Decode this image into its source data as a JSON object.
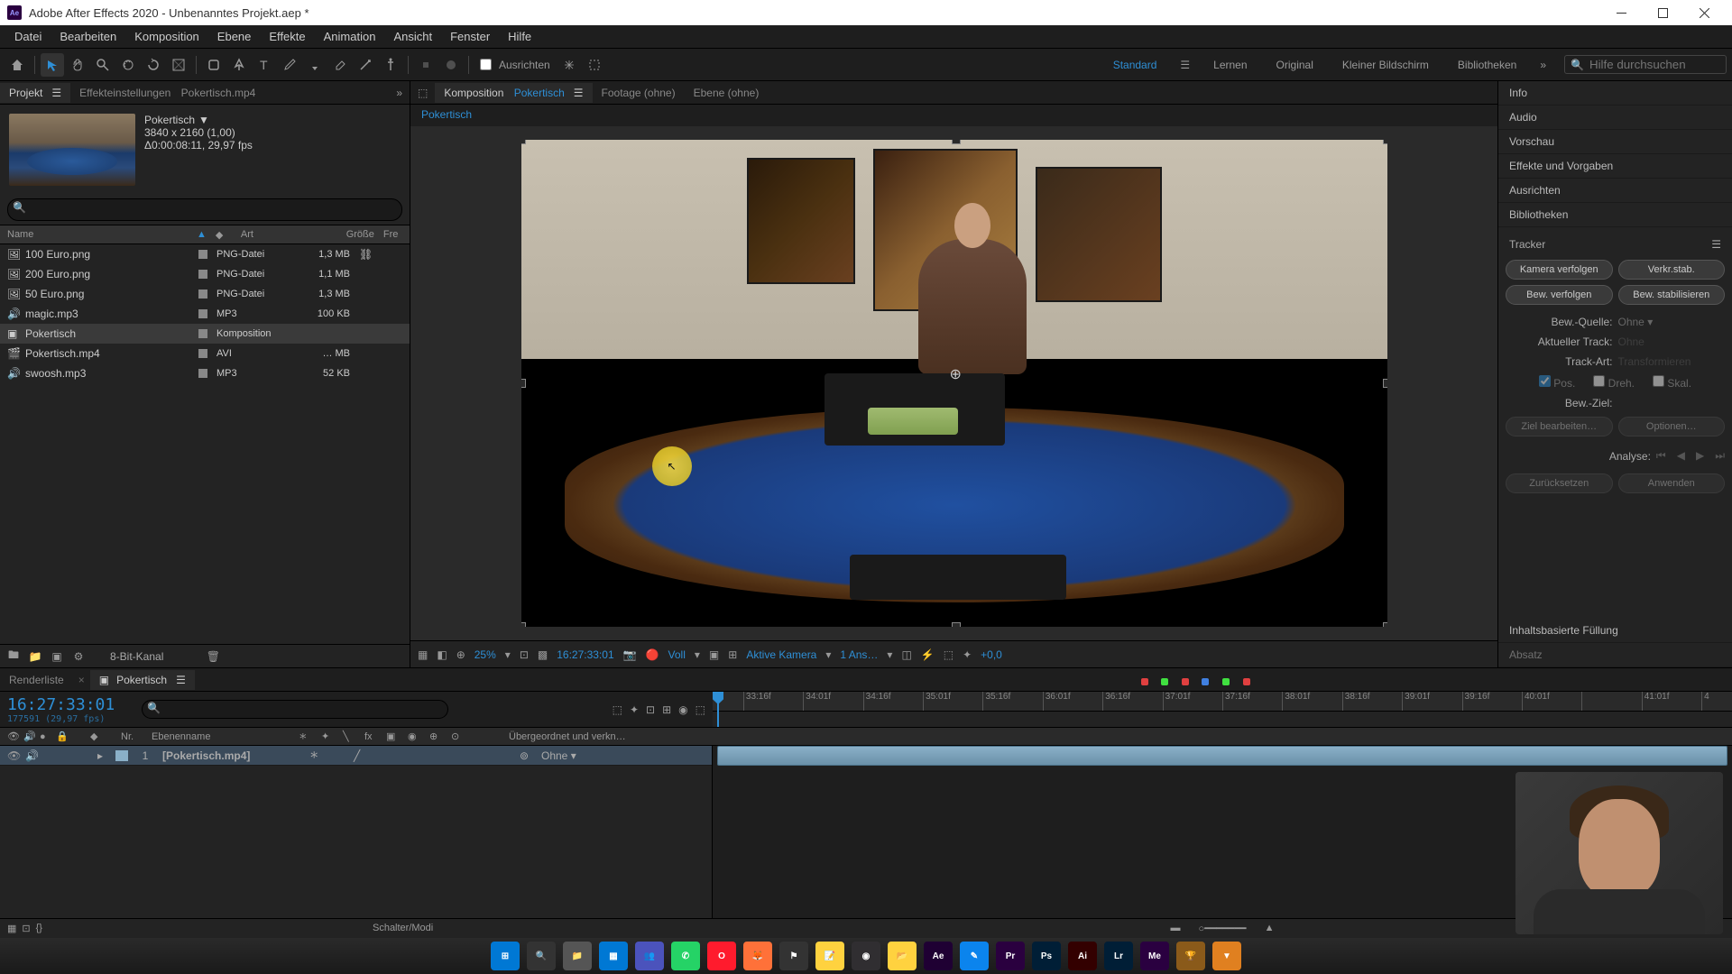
{
  "window": {
    "app": "Ae",
    "title": "Adobe After Effects 2020 - Unbenanntes Projekt.aep *"
  },
  "menu": [
    "Datei",
    "Bearbeiten",
    "Komposition",
    "Ebene",
    "Effekte",
    "Animation",
    "Ansicht",
    "Fenster",
    "Hilfe"
  ],
  "toolbar": {
    "snap_label": "Ausrichten",
    "workspaces": [
      "Standard",
      "Lernen",
      "Original",
      "Kleiner Bildschirm",
      "Bibliotheken"
    ],
    "active_workspace": "Standard",
    "search_placeholder": "Hilfe durchsuchen"
  },
  "project": {
    "tab_project": "Projekt",
    "tab_effectsettings": "Effekteinstellungen",
    "tab_effectsettings_target": "Pokertisch.mp4",
    "selected_name": "Pokertisch",
    "meta_res": "3840 x 2160 (1,00)",
    "meta_dur": "Δ0:00:08:11, 29,97 fps",
    "cols": {
      "name": "Name",
      "type": "Art",
      "size": "Größe",
      "fr": "Fre"
    },
    "footer_bit": "8-Bit-Kanal",
    "assets": [
      {
        "name": "100 Euro.png",
        "type": "PNG-Datei",
        "size": "1,3 MB",
        "icon": "image",
        "link": true
      },
      {
        "name": "200 Euro.png",
        "type": "PNG-Datei",
        "size": "1,1 MB",
        "icon": "image"
      },
      {
        "name": "50 Euro.png",
        "type": "PNG-Datei",
        "size": "1,3 MB",
        "icon": "image"
      },
      {
        "name": "magic.mp3",
        "type": "MP3",
        "size": "100 KB",
        "icon": "audio"
      },
      {
        "name": "Pokertisch",
        "type": "Komposition",
        "size": "",
        "icon": "comp",
        "selected": true
      },
      {
        "name": "Pokertisch.mp4",
        "type": "AVI",
        "size": "… MB",
        "icon": "video"
      },
      {
        "name": "swoosh.mp3",
        "type": "MP3",
        "size": "52 KB",
        "icon": "audio"
      }
    ]
  },
  "viewer": {
    "tab_comp_prefix": "Komposition",
    "tab_comp_name": "Pokertisch",
    "tab_footage": "Footage (ohne)",
    "tab_layer": "Ebene (ohne)",
    "breadcrumb": "Pokertisch",
    "footer": {
      "zoom": "25%",
      "timecode": "16:27:33:01",
      "resolution": "Voll",
      "camera": "Aktive Kamera",
      "views": "1 Ans…",
      "exposure": "+0,0"
    }
  },
  "right": {
    "panels": [
      "Info",
      "Audio",
      "Vorschau",
      "Effekte und Vorgaben",
      "Ausrichten",
      "Bibliotheken"
    ],
    "tracker": {
      "title": "Tracker",
      "btns": {
        "track_camera": "Kamera verfolgen",
        "warp_stab": "Verkr.stab.",
        "track_motion": "Bew. verfolgen",
        "stabilize": "Bew. stabilisieren"
      },
      "motion_source_lab": "Bew.-Quelle:",
      "motion_source_val": "Ohne",
      "current_track_lab": "Aktueller Track:",
      "current_track_val": "Ohne",
      "track_type_lab": "Track-Art:",
      "track_type_val": "Transformieren",
      "cb_pos": "Pos.",
      "cb_rot": "Dreh.",
      "cb_scale": "Skal.",
      "motion_target_lab": "Bew.-Ziel:",
      "edit_target": "Ziel bearbeiten…",
      "options": "Optionen…",
      "analyze_lab": "Analyse:",
      "reset": "Zurücksetzen",
      "apply": "Anwenden"
    },
    "content_aware": "Inhaltsbasierte Füllung",
    "absatz": "Absatz"
  },
  "timeline": {
    "tab_render": "Renderliste",
    "tab_comp": "Pokertisch",
    "timecode": "16:27:33:01",
    "timecode_sub": "177591 (29,97 fps)",
    "cols": {
      "nr": "Nr.",
      "layer": "Ebenenname",
      "parent": "Übergeordnet und verkn…"
    },
    "layer": {
      "nr": "1",
      "name": "[Pokertisch.mp4]",
      "parent": "Ohne"
    },
    "footer_label": "Schalter/Modi",
    "ticks": [
      "33:16f",
      "34:01f",
      "34:16f",
      "35:01f",
      "35:16f",
      "36:01f",
      "36:16f",
      "37:01f",
      "37:16f",
      "38:01f",
      "38:16f",
      "39:01f",
      "39:16f",
      "40:01f",
      "",
      "41:01f",
      "4"
    ]
  },
  "taskbar": {
    "icons": [
      {
        "name": "start",
        "bg": "#0078d4",
        "txt": "⊞"
      },
      {
        "name": "search",
        "bg": "#333",
        "txt": "🔍"
      },
      {
        "name": "explorer",
        "bg": "#555",
        "txt": "📁"
      },
      {
        "name": "tasks",
        "bg": "#0078d4",
        "txt": "▦"
      },
      {
        "name": "teams",
        "bg": "#4b53bc",
        "txt": "👥"
      },
      {
        "name": "whatsapp",
        "bg": "#25d366",
        "txt": "✆"
      },
      {
        "name": "opera",
        "bg": "#ff1b2d",
        "txt": "O"
      },
      {
        "name": "firefox",
        "bg": "#ff7139",
        "txt": "🦊"
      },
      {
        "name": "app1",
        "bg": "#333",
        "txt": "⚑"
      },
      {
        "name": "notes",
        "bg": "#ffd23f",
        "txt": "📝"
      },
      {
        "name": "obs",
        "bg": "#302e31",
        "txt": "◉"
      },
      {
        "name": "files",
        "bg": "#ffd23f",
        "txt": "📂"
      },
      {
        "name": "ae",
        "bg": "#1f0033",
        "txt": "Ae"
      },
      {
        "name": "app2",
        "bg": "#0b84ed",
        "txt": "✎"
      },
      {
        "name": "pr",
        "bg": "#2a003f",
        "txt": "Pr"
      },
      {
        "name": "ps",
        "bg": "#001e36",
        "txt": "Ps"
      },
      {
        "name": "ai",
        "bg": "#330000",
        "txt": "Ai"
      },
      {
        "name": "lr",
        "bg": "#001e36",
        "txt": "Lr"
      },
      {
        "name": "me",
        "bg": "#2a0040",
        "txt": "Me"
      },
      {
        "name": "app3",
        "bg": "#8a5a1a",
        "txt": "🏆"
      },
      {
        "name": "app4",
        "bg": "#e08020",
        "txt": "▼"
      }
    ]
  }
}
